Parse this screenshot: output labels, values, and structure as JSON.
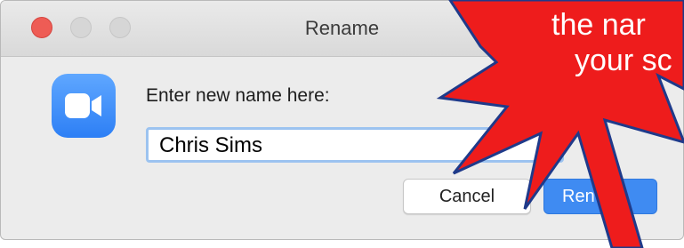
{
  "window": {
    "title": "Rename"
  },
  "dialog": {
    "prompt": "Enter new name here:",
    "name_value": "Chris Sims",
    "cancel_label": "Cancel",
    "rename_label_visible": "Ren"
  },
  "callout": {
    "line1": "the nar",
    "line2": "your sc",
    "color": "#ee1c1c",
    "stroke": "#1f3a8a"
  },
  "icons": {
    "app_icon": "video-camera-icon",
    "close": "close-traffic-light-icon",
    "minimize": "minimize-traffic-light-icon",
    "maximize": "maximize-traffic-light-icon"
  },
  "colors": {
    "accent": "#3f8bf2",
    "app_icon_blue": "#2d7ff5",
    "close_red": "#ee5c55"
  }
}
